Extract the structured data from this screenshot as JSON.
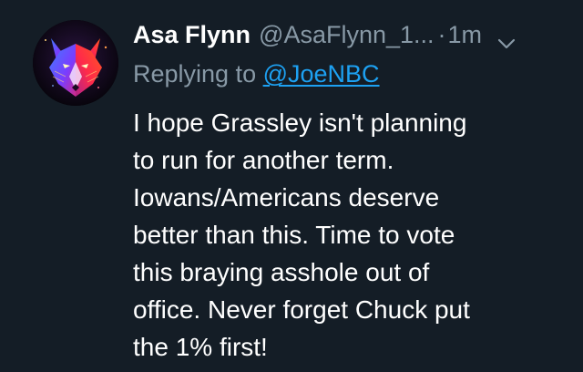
{
  "tweet": {
    "display_name": "Asa Flynn",
    "handle": "@AsaFlynn_1...",
    "separator": "·",
    "time": "1m",
    "reply_prefix": "Replying to ",
    "reply_to": "@JoeNBC",
    "body_lines": [
      "I hope Grassley isn't planning",
      "to run for another term.",
      "Iowans/Americans deserve",
      "better than this. Time to vote",
      "this braying asshole out of",
      "office. Never forget Chuck put",
      "the 1% first!"
    ]
  },
  "icons": {
    "avatar": "wolf-avatar-icon",
    "menu": "chevron-down-icon"
  },
  "colors": {
    "background": "#141d26",
    "primary_text": "#ffffff",
    "secondary_text": "#8899a6",
    "link": "#1da1f2"
  }
}
